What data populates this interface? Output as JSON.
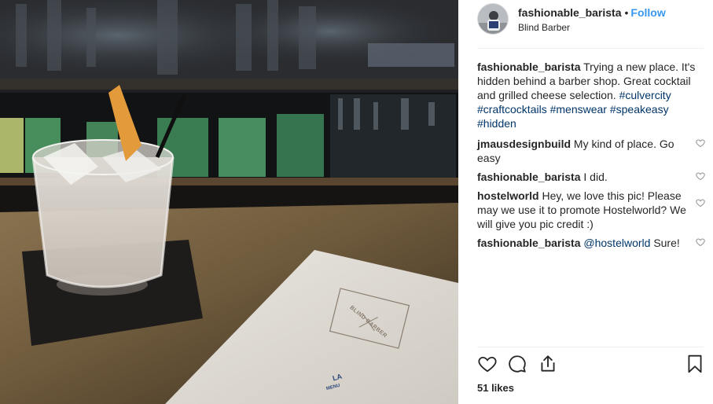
{
  "post": {
    "username": "fashionable_barista",
    "follow_label": "Follow",
    "location": "Blind Barber",
    "photo_menu_brand": "BLIND BARBER",
    "photo_menu_city": "LA",
    "photo_menu_word": "MENU"
  },
  "caption": {
    "username": "fashionable_barista",
    "text": "Trying a new place. It's hidden behind a barber shop. Great cocktail and grilled cheese selection.",
    "hashtags": [
      "#culvercity",
      "#craftcocktails",
      "#menswear",
      "#speakeasy",
      "#hidden"
    ]
  },
  "comments": [
    {
      "username": "jmausdesignbuild",
      "text": "My kind of place. Go easy"
    },
    {
      "username": "fashionable_barista",
      "text": "I did."
    },
    {
      "username": "hostelworld",
      "text": "Hey, we love this pic! Please may we use it to promote Hostelworld? We will give you pic credit :)"
    },
    {
      "username": "fashionable_barista",
      "mention": "@hostelworld",
      "text": "Sure!"
    }
  ],
  "likes": "51 likes",
  "icons": {
    "like": "heart-icon",
    "comment": "comment-icon",
    "share": "share-icon",
    "save": "bookmark-icon"
  },
  "colors": {
    "link": "#3897f0",
    "hashtag": "#003569",
    "text": "#262626"
  }
}
